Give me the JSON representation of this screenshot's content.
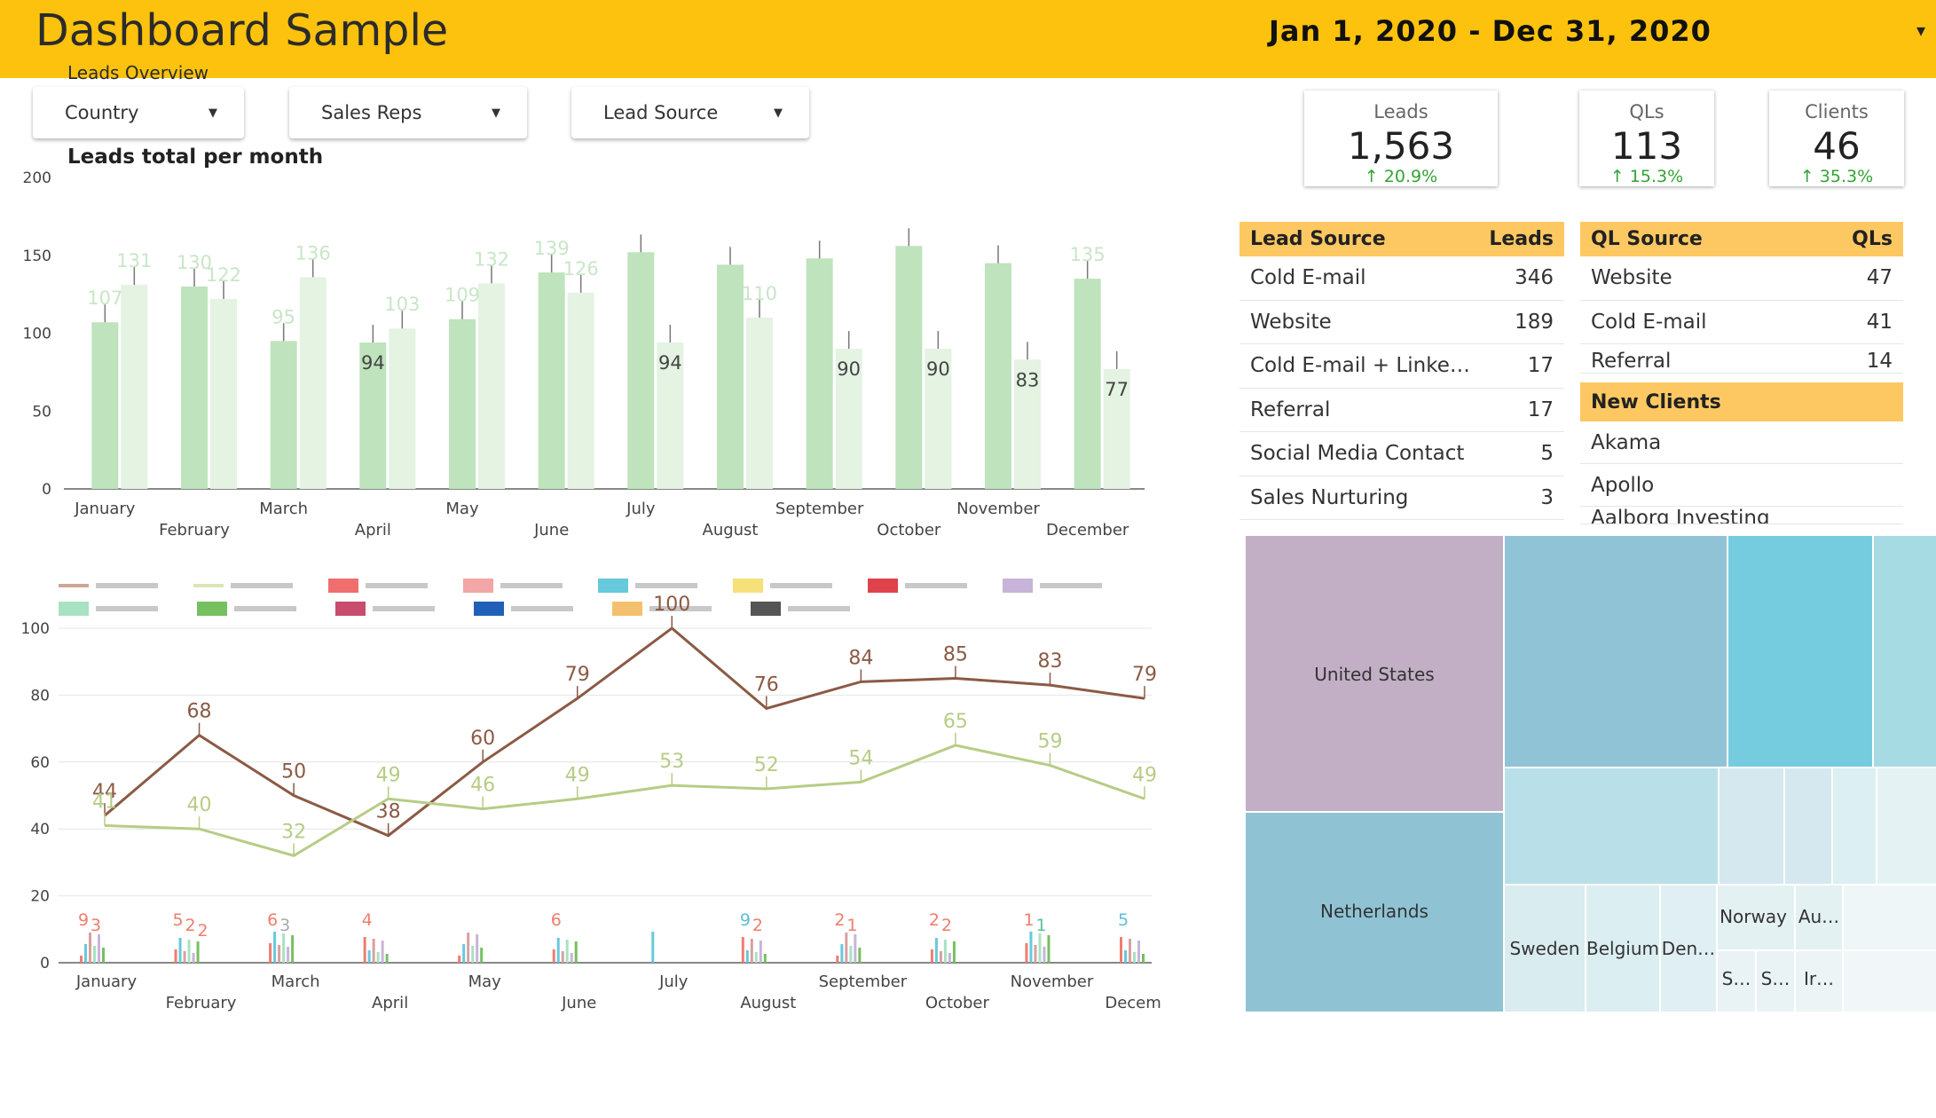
{
  "header": {
    "title": "Dashboard Sample",
    "subtitle": "Leads Overview",
    "date_range": "Jan 1, 2020 - Dec 31, 2020",
    "accent_color": "#fdc20d"
  },
  "filters": [
    {
      "label": "Country"
    },
    {
      "label": "Sales Reps"
    },
    {
      "label": "Lead Source"
    }
  ],
  "kpis": [
    {
      "label": "Leads",
      "value": "1,563",
      "delta": "↑ 20.9%"
    },
    {
      "label": "QLs",
      "value": "113",
      "delta": "↑ 15.3%"
    },
    {
      "label": "Clients",
      "value": "46",
      "delta": "↑ 35.3%"
    }
  ],
  "lead_source_table": {
    "header": [
      "Lead Source",
      "Leads"
    ],
    "rows": [
      [
        "Cold E-mail",
        "346"
      ],
      [
        "Website",
        "189"
      ],
      [
        "Cold E-mail + Linke…",
        "17"
      ],
      [
        "Referral",
        "17"
      ],
      [
        "Social Media Contact",
        "5"
      ],
      [
        "Sales Nurturing",
        "3"
      ]
    ]
  },
  "ql_source_table": {
    "header": [
      "QL Source",
      "QLs"
    ],
    "rows": [
      [
        "Website",
        "47"
      ],
      [
        "Cold E-mail",
        "41"
      ],
      [
        "Referral",
        "14"
      ]
    ]
  },
  "new_clients": {
    "header": "New Clients",
    "rows": [
      "Akama",
      "Apollo",
      "Aalborg Investing"
    ]
  },
  "chart_data": [
    {
      "type": "bar",
      "title": "Leads total per month",
      "categories": [
        "January",
        "February",
        "March",
        "April",
        "May",
        "June",
        "July",
        "August",
        "September",
        "October",
        "November",
        "December"
      ],
      "series": [
        {
          "values": [
            107,
            130,
            95,
            94,
            109,
            139,
            152,
            144,
            148,
            156,
            145,
            135
          ],
          "color": "#bfe3bd"
        },
        {
          "values": [
            131,
            122,
            136,
            103,
            132,
            126,
            94,
            110,
            90,
            90,
            83,
            77
          ],
          "color": "#e4f3e2"
        }
      ],
      "data_labels": [
        "107",
        "131",
        "130",
        "122",
        "95",
        "136",
        "94",
        "103",
        "109",
        "132",
        "139",
        "126",
        "94",
        "110",
        "90",
        "90",
        "83",
        "135",
        "77"
      ],
      "ylim": [
        0,
        200
      ],
      "yticks": [
        0,
        50,
        100,
        150,
        200
      ]
    },
    {
      "type": "line",
      "categories": [
        "January",
        "February",
        "March",
        "April",
        "May",
        "June",
        "July",
        "August",
        "September",
        "October",
        "November",
        "December"
      ],
      "series": [
        {
          "values": [
            44,
            68,
            50,
            38,
            60,
            79,
            100,
            76,
            84,
            85,
            83,
            79
          ],
          "color": "#8b5a44"
        },
        {
          "values": [
            41,
            40,
            32,
            49,
            46,
            49,
            53,
            52,
            54,
            65,
            59,
            49
          ],
          "color": "#b7cc85"
        }
      ],
      "small_bar_labels": [
        {
          "month": 0,
          "text": "9",
          "color": "#ef7d6e"
        },
        {
          "month": 0,
          "text": "3",
          "color": "#ef7d6e"
        },
        {
          "month": 1,
          "text": "5",
          "color": "#ef7d6e"
        },
        {
          "month": 1,
          "text": "2",
          "color": "#ef7d6e"
        },
        {
          "month": 1,
          "text": "2",
          "color": "#ef7d6e"
        },
        {
          "month": 2,
          "text": "6",
          "color": "#ef7d6e"
        },
        {
          "month": 2,
          "text": "3",
          "color": "#aaaaaa"
        },
        {
          "month": 3,
          "text": "4",
          "color": "#ef7d6e"
        },
        {
          "month": 5,
          "text": "6",
          "color": "#ef7d6e"
        },
        {
          "month": 7,
          "text": "9",
          "color": "#5bc0d9"
        },
        {
          "month": 7,
          "text": "2",
          "color": "#ef7d6e"
        },
        {
          "month": 8,
          "text": "2",
          "color": "#ef7d6e"
        },
        {
          "month": 8,
          "text": "1",
          "color": "#ef7d6e"
        },
        {
          "month": 9,
          "text": "2",
          "color": "#ef7d6e"
        },
        {
          "month": 9,
          "text": "2",
          "color": "#ef7d6e"
        },
        {
          "month": 10,
          "text": "1",
          "color": "#ef7d6e"
        },
        {
          "month": 10,
          "text": "1",
          "color": "#5bc0a0"
        },
        {
          "month": 11,
          "text": "5",
          "color": "#5bc0d9"
        }
      ],
      "legend_colors": [
        "#c9a894",
        "#d9e6b5",
        "#ef6f6f",
        "#f2a6a6",
        "#66c9dc",
        "#f6e07a",
        "#e0424c",
        "#c8b4d8",
        "#a8e2c2",
        "#76c060",
        "#c84c6e",
        "#2060b8",
        "#f4c070",
        "#555555"
      ],
      "ylim": [
        0,
        100
      ],
      "yticks": [
        0,
        20,
        40,
        60,
        80,
        100
      ]
    },
    {
      "type": "treemap",
      "labels": [
        "United States",
        "Netherlands",
        "Sweden",
        "Belgium",
        "Den…",
        "Norway",
        "Au…",
        "S…",
        "S…",
        "Ir…"
      ]
    }
  ]
}
